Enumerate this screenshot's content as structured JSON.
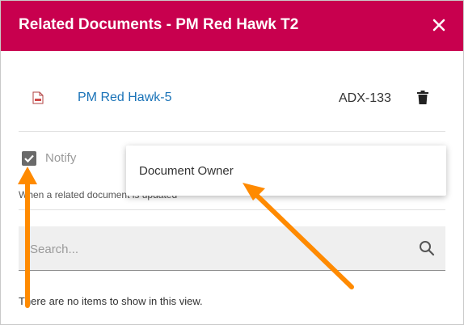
{
  "dialog": {
    "title": "Related Documents - PM Red Hawk T2",
    "close_icon": "close-icon"
  },
  "document": {
    "name": "PM Red Hawk-5",
    "code": "ADX-133",
    "icon": "document-icon",
    "delete_icon": "trash-icon"
  },
  "notify": {
    "label": "Notify",
    "checked": true,
    "help_text": "When a related document is updated"
  },
  "dropdown": {
    "selected_option": "Document Owner"
  },
  "search": {
    "placeholder": "Search...",
    "icon": "search-icon"
  },
  "list": {
    "empty_message": "There are no items to show in this view."
  },
  "colors": {
    "header": "#c8004e",
    "link": "#1a73b8",
    "annotation_arrow": "#ff8a00"
  }
}
